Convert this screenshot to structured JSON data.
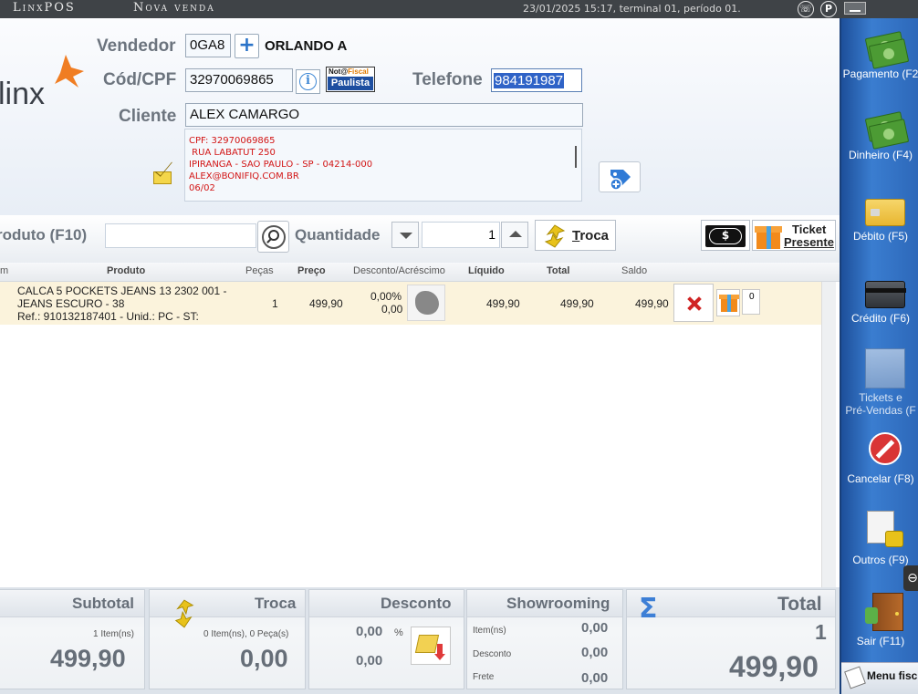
{
  "titlebar": {
    "app_name": "LinxPOS",
    "screen": "Nova venda",
    "info": "23/01/2025 15:17, terminal 01, período 01.",
    "icon_a": "☏",
    "icon_p": "P"
  },
  "brand": {
    "logo_text": "linx",
    "accent": "#f07d22"
  },
  "customer": {
    "vendedor_label": "Vendedor",
    "vendedor_code": "0GA8",
    "vendedor_name": "ORLANDO A",
    "cpf_label": "Cód/CPF",
    "cpf_value": "32970069865",
    "telefone_label": "Telefone",
    "telefone_value": "984191987",
    "cliente_label": "Cliente",
    "cliente_value": "ALEX CAMARGO",
    "nota_fiscal_line1_a": "Not@",
    "nota_fiscal_line1_b": "Fiscal",
    "nota_fiscal_line2": "Paulista",
    "address_lines": [
      "CPF: 32970069865",
      " RUA LABATUT 250",
      "IPIRANGA - SAO PAULO - SP - 04214-000",
      "ALEX@BONIFIQ.COM.BR",
      "06/02"
    ]
  },
  "product_bar": {
    "produto_label": "roduto (F10)",
    "produto_value": "",
    "quantidade_label": "Quantidade",
    "quantidade_value": "1",
    "troca_label_t": "T",
    "troca_label_rest": "roca",
    "ticket_line1": "Ticket",
    "ticket_line2": "Presente"
  },
  "table": {
    "headers": {
      "item": "m",
      "produto": "Produto",
      "pecas": "Peças",
      "preco": "Preço",
      "desconto": "Desconto/Acréscimo",
      "liquido": "Líquido",
      "total": "Total",
      "saldo": "Saldo"
    },
    "rows": [
      {
        "desc1": "CALCA 5 POCKETS JEANS 13 2302 001 -",
        "desc2": "JEANS ESCURO - 38",
        "desc3": "Ref.: 910132187401 - Unid.: PC - ST:",
        "pecas": "1",
        "preco": "499,90",
        "desconto_pct": "0,00%",
        "desconto_val": "0,00",
        "liquido": "499,90",
        "total": "499,90",
        "saldo": "499,90",
        "extra": "0"
      }
    ]
  },
  "footer": {
    "subtotal_label": "Subtotal",
    "subtotal_items": "1 Item(ns)",
    "subtotal_value": "499,90",
    "troca_label": "Troca",
    "troca_items": "0 Item(ns), 0 Peça(s)",
    "troca_value": "0,00",
    "desconto_label": "Desconto",
    "desconto_pct": "0,00",
    "desconto_pct_sign": "%",
    "desconto_value": "0,00",
    "showrooming_label": "Showrooming",
    "showrooming_item_label": "Item(ns)",
    "showrooming_item_value": "0,00",
    "showrooming_desconto_label": "Desconto",
    "showrooming_desconto_value": "0,00",
    "showrooming_frete_label": "Frete",
    "showrooming_frete_value": "0,00",
    "total_label": "Total",
    "total_count": "1",
    "total_value": "499,90",
    "sigma": "Σ"
  },
  "sidebar": {
    "items": [
      {
        "label": "Pagamento (F2",
        "icon": "money-icon"
      },
      {
        "label": "Dinheiro (F4)",
        "icon": "money-icon"
      },
      {
        "label": "Débito (F5)",
        "icon": "debit-card-icon"
      },
      {
        "label": "Crédito (F6)",
        "icon": "credit-card-icon"
      },
      {
        "label1": "Tickets e",
        "label2": "Pré-Vendas (F",
        "icon": "tickets-icon"
      },
      {
        "label": "Cancelar (F8)",
        "icon": "cancel-icon"
      },
      {
        "label": "Outros (F9)",
        "icon": "others-icon"
      },
      {
        "label": "Sair (F11)",
        "icon": "exit-door-icon"
      }
    ],
    "menu_fiscal": "Menu fisc"
  }
}
